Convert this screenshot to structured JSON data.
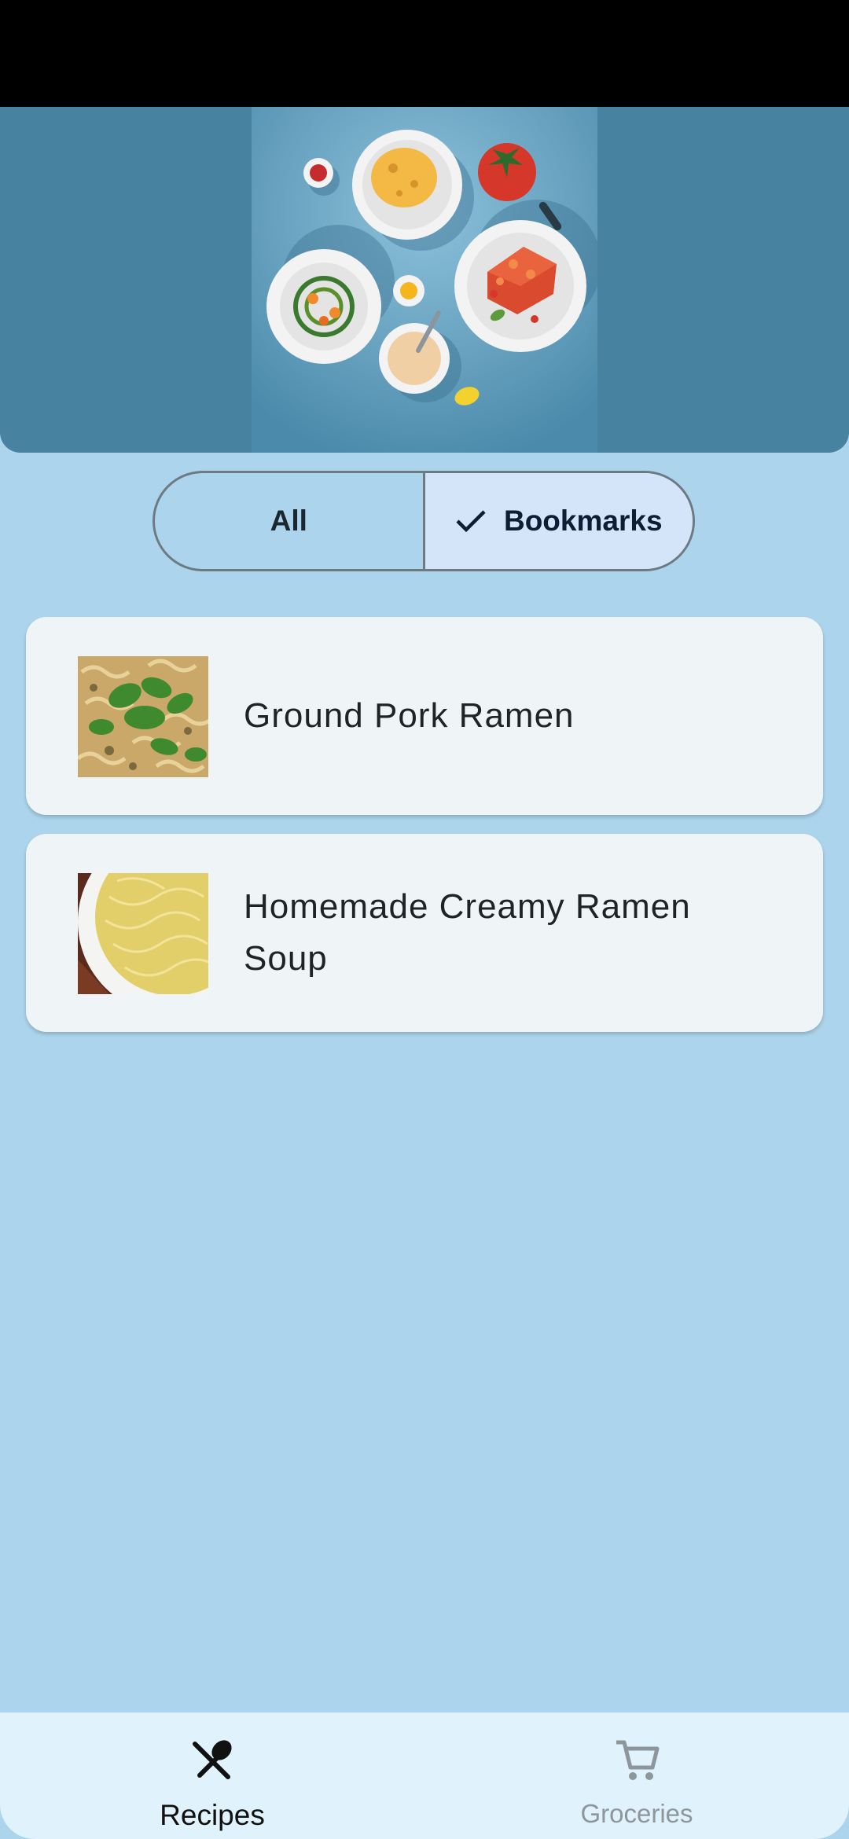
{
  "filter": {
    "options": [
      {
        "label": "All",
        "selected": false
      },
      {
        "label": "Bookmarks",
        "selected": true
      }
    ]
  },
  "recipes": [
    {
      "title": "Ground Pork Ramen",
      "image": "ramen-greens-photo"
    },
    {
      "title": "Homemade Creamy Ramen Soup",
      "image": "creamy-ramen-bowl-photo"
    }
  ],
  "bottom_nav": {
    "items": [
      {
        "label": "Recipes",
        "icon": "fork-spoon-icon",
        "active": true
      },
      {
        "label": "Groceries",
        "icon": "cart-icon",
        "active": false
      }
    ]
  },
  "colors": {
    "background": "#acd4ec",
    "header": "#4783a1",
    "selected_segment": "#d4e5fa",
    "card": "#eff5f7",
    "nav_bar": "#e0f3fc"
  }
}
